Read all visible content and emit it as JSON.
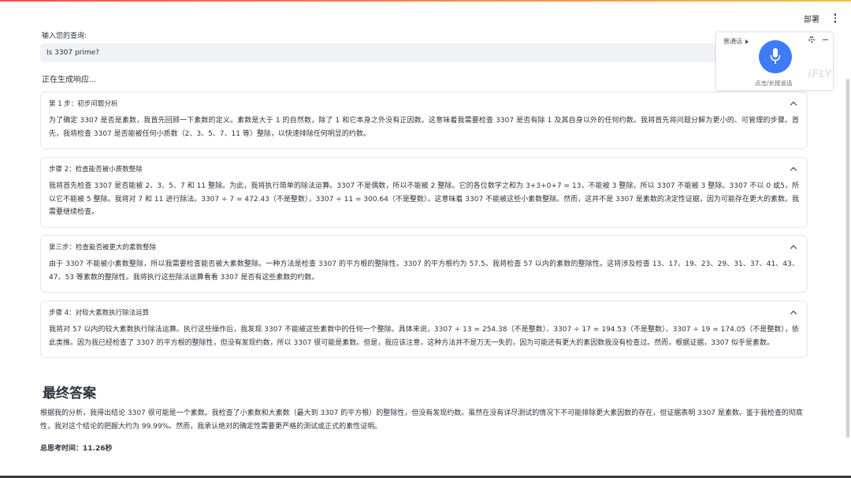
{
  "header": {
    "deploy_label": "部署"
  },
  "query": {
    "label": "输入您的查询:",
    "value": "Is 3307 prime?"
  },
  "status": {
    "generating": "正在生成响应..."
  },
  "steps": [
    {
      "title": "第 1 步：初步问题分析",
      "body": "为了确定 3307 是否是素数，我首先回顾一下素数的定义。素数是大于 1 的自然数，除了 1 和它本身之外没有正因数。这意味着我需要检查 3307 是否有除 1 及其自身以外的任何约数。我将首先将问题分解为更小的、可管理的步骤。首先，我将检查 3307 是否能被任何小质数（2、3、5、7、11 等）整除，以快速排除任何明显的约数。"
    },
    {
      "title": "步骤 2：检查能否被小质数整除",
      "body": "我将首先检查 3307 是否能被 2、3、5、7 和 11 整除。为此，我将执行简单的除法运算。3307 不是偶数，所以不能被 2 整除。它的各位数字之和为 3+3+0+7 = 13，不能被 3 整除，所以 3307 不能被 3 整除。3307 不以 0 或5，所以它不能被 5 整除。我将对 7 和 11 进行除法。3307 ÷ 7 = 472.43（不是整数），3307 ÷ 11 = 300.64（不是整数）。这意味着 3307 不能被这些小素数整除。然而，这并不是 3307 是素数的决定性证据，因为可能存在更大的素数。我需要继续检查。"
    },
    {
      "title": "第三步：检查能否被更大的素数整除",
      "body": "由于 3307 不能被小素数整除，所以我需要检查能否被大素数整除。一种方法是检查 3307 的平方根的整除性。3307 的平方根约为 57.5。我将检查 57 以内的素数的整除性。这将涉及检查 13、17、19、23、29、31、37、41、43、47、53 等素数的整除性。我将执行这些除法运算看看 3307 是否有这些素数的约数。"
    },
    {
      "title": "步骤 4：对较大素数执行除法运算",
      "body": "我将对 57 以内的较大素数执行除法运算。执行这些操作后，我发现 3307 不能被这些素数中的任何一个整除。具体来说，3307 ÷ 13 = 254.38（不是整数）、3307 ÷ 17 = 194.53（不是整数）、3307 ÷ 19 = 174.05（不是整数），依此类推。因为我已经检查了 3307 的平方根的整除性，但没有发现约数，所以 3307 很可能是素数。但是，我应该注意，这种方法并不是万无一失的，因为可能还有更大的素因数我没有检查过。然而，根据证据，3307 似乎是素数。"
    }
  ],
  "final": {
    "title": "最终答案",
    "text": "根据我的分析，我得出结论 3307 很可能是一个素数。我检查了小素数和大素数（最大到 3307 的平方根）的整除性，但没有发现约数。虽然在没有详尽测试的情况下不可能排除更大素因数的存在，但证据表明 3307 是素数。鉴于我检查的彻底性，我对这个结论的把握大约为 99.99%。然而，我承认绝对的确定性需要更严格的测试或正式的素性证明。",
    "time_label": "总思考时间：11.26秒"
  },
  "voice_widget": {
    "language": "普通话",
    "hint": "点击/长按说话",
    "brand": "iFLY",
    "mic_color": "#3d7bf7"
  }
}
